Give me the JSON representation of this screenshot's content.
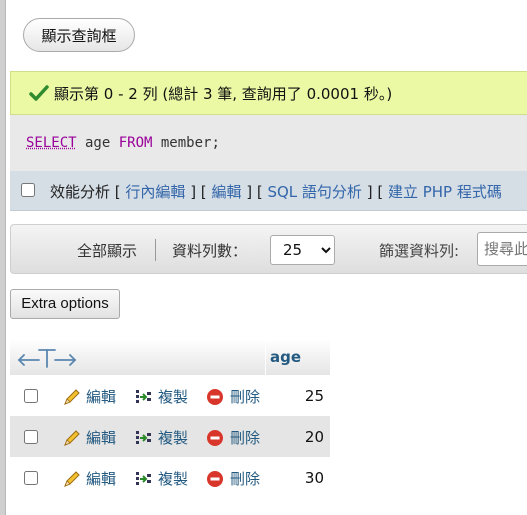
{
  "top": {
    "show_query_label": "顯示查詢框"
  },
  "success": {
    "message": "顯示第 0 - 2 列 (總計 3 筆, 查詢用了 0.0001 秒。)"
  },
  "sql": {
    "select_kw": "SELECT",
    "mid1": " age ",
    "from_kw": "FROM",
    "mid2": " member;"
  },
  "links": {
    "profiling": "效能分析",
    "open1": " [ ",
    "inline_edit": "行內編輯",
    "sep1": " ] [ ",
    "edit": "編輯",
    "sep2": " ] [ ",
    "explain_sql": "SQL 語句分析",
    "sep3": " ] [ ",
    "create_php": "建立 PHP 程式碼"
  },
  "nav": {
    "show_all": "全部顯示",
    "rows_label": "資料列數：",
    "rows_value": "25",
    "filter_label": "篩選資料列:",
    "search_placeholder": "搜尋此"
  },
  "extra_options_label": "Extra options",
  "table": {
    "column": "age",
    "action_labels": {
      "edit": "編輯",
      "copy": "複製",
      "delete": "刪除"
    },
    "rows": [
      "25",
      "20",
      "30"
    ]
  },
  "colors": {
    "success_bg": "#ebf8a4",
    "link": "#3366aa",
    "keyword": "#990099",
    "header_text": "#235a81"
  },
  "icons": [
    "check-icon",
    "column-arrows-icon",
    "pencil-icon",
    "copy-icon",
    "delete-icon"
  ]
}
